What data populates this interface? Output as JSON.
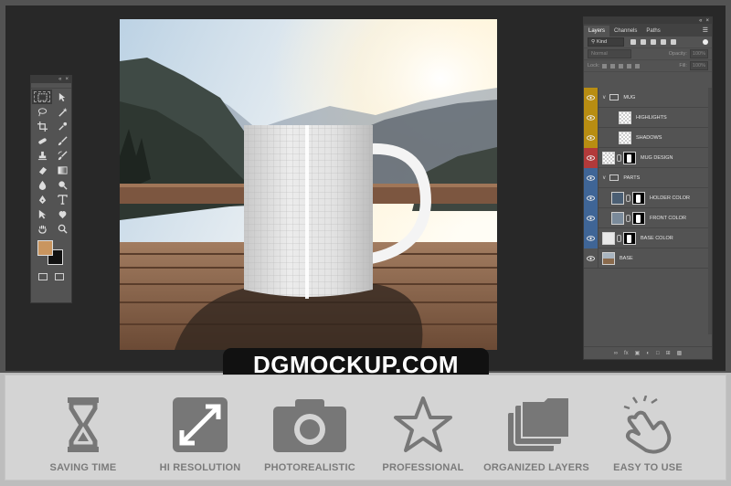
{
  "app": {
    "name": "Photoshop mockup workspace"
  },
  "layers_panel": {
    "tabs": [
      {
        "label": "Layers",
        "active": true
      },
      {
        "label": "Channels",
        "active": false
      },
      {
        "label": "Paths",
        "active": false
      }
    ],
    "filter_kind": "Kind",
    "blend_mode": "Normal",
    "opacity_label": "Opacity:",
    "opacity_value": "100%",
    "lock_label": "Lock:",
    "fill_label": "Fill:",
    "fill_value": "100%",
    "layers": [
      {
        "name": "MUG",
        "type": "group",
        "color": "#b88d12"
      },
      {
        "name": "HIGHLIGHTS",
        "type": "layer",
        "color": "#b88d12"
      },
      {
        "name": "SHADOWS",
        "type": "layer",
        "color": "#b88d12"
      },
      {
        "name": "MUG DESIGN",
        "type": "smart-object",
        "color": "#b23a3a"
      },
      {
        "name": "PARTS",
        "type": "group",
        "color": "#3f6596"
      },
      {
        "name": "HOLDER COLOR",
        "type": "fill-layer",
        "color": "#3f6596"
      },
      {
        "name": "FRONT COLOR",
        "type": "fill-layer",
        "color": "#3f6596"
      },
      {
        "name": "BASE COLOR",
        "type": "fill-layer",
        "color": "#3f6596"
      },
      {
        "name": "BASE",
        "type": "image",
        "color": "#535353"
      }
    ]
  },
  "tools_panel": {
    "foreground_color": "#c9955f",
    "background_color": "#111111"
  },
  "brand": {
    "text": "DGMOCKUP.COM"
  },
  "features": [
    {
      "icon": "hourglass-icon",
      "label": "SAVING TIME"
    },
    {
      "icon": "expand-arrows-icon",
      "label": "HI RESOLUTION"
    },
    {
      "icon": "camera-icon",
      "label": "PHOTOREALISTIC"
    },
    {
      "icon": "star-icon",
      "label": "PROFESSIONAL"
    },
    {
      "icon": "stacked-layers-icon",
      "label": "ORGANIZED LAYERS"
    },
    {
      "icon": "tap-hand-icon",
      "label": "EASY TO USE"
    }
  ],
  "colors": {
    "workspace_bg": "#282828",
    "panel_bg": "#535353",
    "feature_strip_bg": "#d4d4d4",
    "feature_icon": "#777777"
  }
}
